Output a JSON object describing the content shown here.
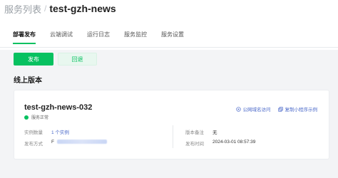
{
  "breadcrumb": {
    "parent": "服务列表",
    "separator": "/",
    "current": "test-gzh-news"
  },
  "tabs": [
    {
      "label": "部署发布",
      "active": true
    },
    {
      "label": "云端调试",
      "active": false
    },
    {
      "label": "运行日志",
      "active": false
    },
    {
      "label": "服务监控",
      "active": false
    },
    {
      "label": "服务设置",
      "active": false
    }
  ],
  "actions": {
    "publish_label": "发布",
    "rollback_label": "回退"
  },
  "section": {
    "online_title": "线上版本"
  },
  "version_card": {
    "name": "test-gzh-news-032",
    "status": "服务正常",
    "status_color": "#07c160",
    "links": {
      "public_domain": "公网域名访问",
      "copy_mini": "复制小程序示例"
    },
    "fields": {
      "instances_label": "实例数量",
      "instances_value": "1 个实例",
      "method_label": "发布方式",
      "method_value": "F",
      "remark_label": "版本备注",
      "remark_value": "无",
      "time_label": "发布时间",
      "time_value": "2024-03-01 08:57:39"
    }
  },
  "colors": {
    "accent": "#07c160",
    "link": "#4a68c9"
  }
}
